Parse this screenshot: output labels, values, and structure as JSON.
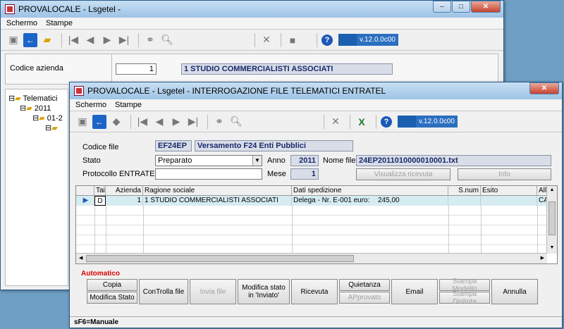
{
  "back_window": {
    "title": "PROVALOCALE - Lsgetel -",
    "menu": [
      "Schermo",
      "Stampe"
    ],
    "version": "v.12.0.0c00",
    "codice_azienda_label": "Codice azienda",
    "codice_azienda_value": "1",
    "azienda_name": "1 STUDIO COMMERCIALISTI ASSOCIATI",
    "tree": [
      "Telematici",
      "2011",
      "01-2"
    ]
  },
  "front_window": {
    "title": "PROVALOCALE - Lsgetel - INTERROGAZIONE FILE TELEMATICI ENTRATEL",
    "menu": [
      "Schermo",
      "Stampe"
    ],
    "version": "v.12.0.0c00",
    "form": {
      "codice_file_label": "Codice file",
      "codice_file_value": "EF24EP",
      "codice_file_desc": "Versamento F24 Enti Pubblici",
      "stato_label": "Stato",
      "stato_value": "Preparato",
      "anno_label": "Anno",
      "anno_value": "2011",
      "nome_file_label": "Nome file",
      "nome_file_value": "24EP2011010000010001.txt",
      "protocollo_label": "Protocollo ENTRATEL",
      "protocollo_value": "",
      "mese_label": "Mese",
      "mese_value": "1",
      "visualizza_label": "Visualizza ricevuta",
      "info_label": "Info"
    },
    "grid": {
      "headers": [
        "Tai",
        "Azienda",
        "Ragione sociale",
        "Dati spedizione",
        "S.num",
        "Esito",
        "All"
      ],
      "rows": [
        {
          "tai": "D",
          "azienda": "1",
          "ragione": "1 STUDIO COMMERCIALISTI ASSOCIATI",
          "dati": "Delega - Nr. E-001 euro:",
          "importo": "245,00",
          "snum": "",
          "esito": "",
          "all": "CA"
        }
      ]
    },
    "automatico_label": "Automatico",
    "buttons": {
      "copia": "Copia",
      "modifica_stato": "Modifica Stato",
      "controlla_file": "ConTrolla file",
      "invia_file": "Invia file",
      "modifica_inviato": "Modifica stato in 'Inviato'",
      "ricevuta": "Ricevuta",
      "quietanza": "Quietanza",
      "approvato": "APprovato",
      "email": "Email",
      "stampa_modello": "Stampa Modello",
      "stampa_distinta": "Stampa Distinta",
      "annulla": "Annulla"
    },
    "status": "sF6=Manuale"
  }
}
